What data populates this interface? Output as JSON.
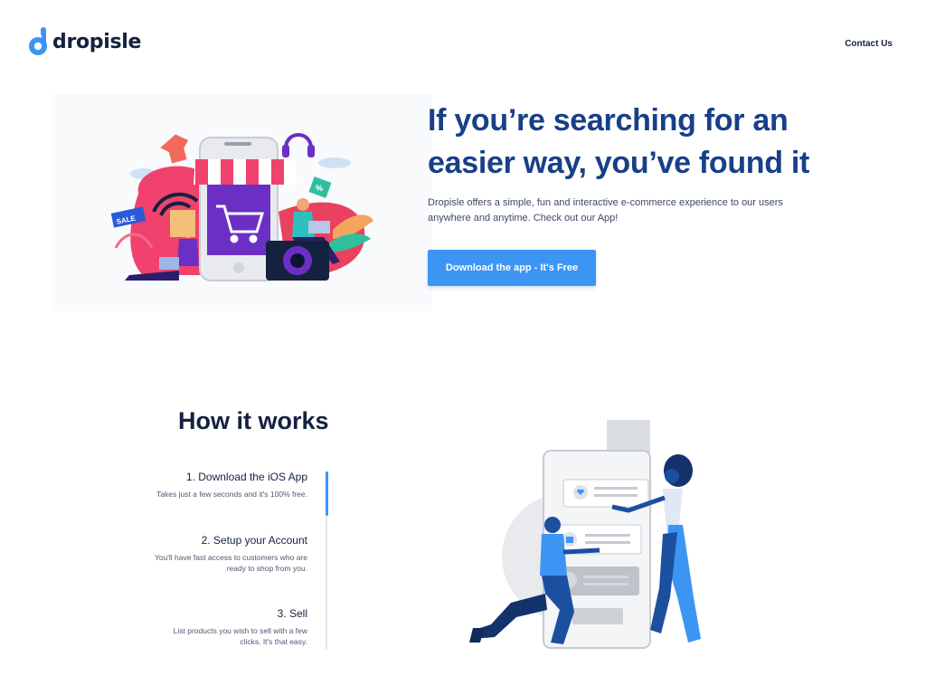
{
  "header": {
    "logo_text": "dropisle",
    "contact_label": "Contact Us"
  },
  "hero": {
    "title": "If you’re searching for an easier way, you’ve found it",
    "description": "Dropisle offers a simple, fun and interactive e-commerce experience to our users anywhere and anytime. Check out our App!",
    "cta_label": "Download the app - It's Free",
    "illustration_tags": {
      "sale_tag": "SALE",
      "percent_tag": "%"
    }
  },
  "how_it_works": {
    "title": "How it works",
    "progress": 0.25,
    "steps": [
      {
        "title": "1. Download the iOS App",
        "desc": "Takes just a few seconds and it's 100% free."
      },
      {
        "title": "2. Setup your Account",
        "desc": "You'll have fast access to customers who are ready to shop from you."
      },
      {
        "title": "3. Sell",
        "desc": "List products you wish to sell with a few clicks. It's that easy."
      }
    ]
  },
  "colors": {
    "brand_blue": "#3c95f3",
    "heading_blue": "#183f88",
    "dark_navy": "#14223f"
  }
}
